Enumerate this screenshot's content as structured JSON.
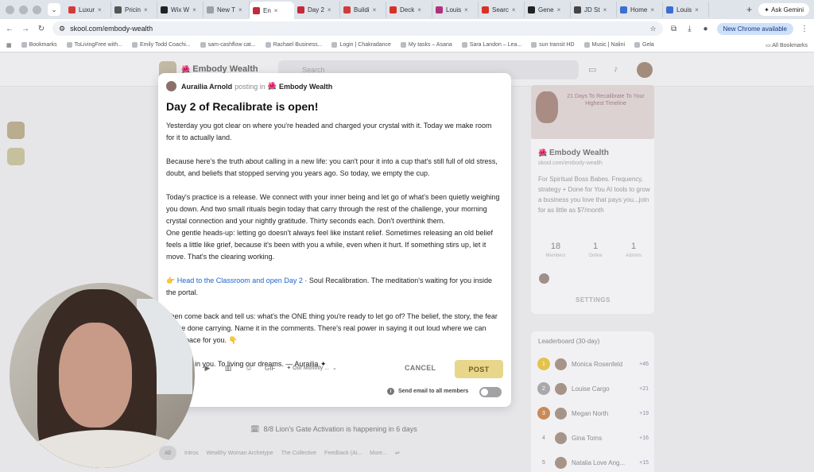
{
  "browser": {
    "tabs": [
      {
        "label": "Luxur",
        "color": "#d33a3a",
        "active": false
      },
      {
        "label": "Pricin",
        "color": "#555555",
        "active": false
      },
      {
        "label": "Wix W",
        "color": "#222222",
        "active": false
      },
      {
        "label": "New T",
        "color": "#9aa0a6",
        "active": false
      },
      {
        "label": "En",
        "color": "#c32a3b",
        "active": true
      },
      {
        "label": "Day 2",
        "color": "#c32a3b",
        "active": false
      },
      {
        "label": "Buildi",
        "color": "#d33a3a",
        "active": false
      },
      {
        "label": "Deck",
        "color": "#d93025",
        "active": false
      },
      {
        "label": "Louis",
        "color": "#b0307a",
        "active": false
      },
      {
        "label": "Searc",
        "color": "#d93025",
        "active": false
      },
      {
        "label": "Gene",
        "color": "#222222",
        "active": false
      },
      {
        "label": "JD St",
        "color": "#444444",
        "active": false
      },
      {
        "label": "Home",
        "color": "#3b6fd4",
        "active": false
      },
      {
        "label": "Louis",
        "color": "#3b6fd4",
        "active": false
      }
    ],
    "new_tab_icon": "+",
    "gemini_label": "Ask Gemini",
    "url": "skool.com/embody-wealth",
    "new_chrome_label": "New Chrome available",
    "bookmarks": [
      "Bookmarks",
      "ToLivingFree with...",
      "Emily Todd Coachi...",
      "sam-cashflow cat...",
      "Rachael Business...",
      "Login | Chakradance",
      "My tasks – Asana",
      "Sara Landon – Lea...",
      "sun transit HD",
      "Music | Nalini",
      "Gela"
    ],
    "all_bookmarks": "All Bookmarks"
  },
  "background": {
    "group_name": "Embody Wealth",
    "search_placeholder": "Search",
    "about_title": "Embody Wealth",
    "about_url": "skool.com/embody-wealth",
    "about_desc": "For Spiritual Boss Babes. Frequency, strategy + Done for You AI tools to grow a business you love that pays you...join for as little as $7/month",
    "banner_text": "21 Days To Recalibrate To Your Highest Timeline",
    "stats": [
      {
        "value": "18",
        "label": "Members"
      },
      {
        "value": "1",
        "label": "Online"
      },
      {
        "value": "1",
        "label": "Admins"
      }
    ],
    "settings_label": "SETTINGS",
    "leaderboard_title": "Leaderboard (30-day)",
    "leaderboard": [
      {
        "rank": "1",
        "name": "Monica Rosenfeld",
        "points": "+46",
        "color": "#e3c34a"
      },
      {
        "rank": "2",
        "name": "Louise Cargo",
        "points": "+21",
        "color": "#a9a9ad"
      },
      {
        "rank": "3",
        "name": "Megan North",
        "points": "+19",
        "color": "#c98a5a"
      },
      {
        "rank": "4",
        "name": "Gina Toms",
        "points": "+16",
        "color": ""
      },
      {
        "rank": "5",
        "name": "Natalia Love Ang...",
        "points": "+15",
        "color": ""
      }
    ],
    "event_prefix": "8/8 Lion's Gate Activation",
    "event_suffix": " is happening in 6 days",
    "chips": [
      "All",
      "Intros",
      "Wealthy Woman Archetype",
      "The Collective",
      "Feedback (Ai...",
      "More..."
    ]
  },
  "modal": {
    "author": "Aurailia Arnold",
    "posting_in": "posting in",
    "group": "Embody Wealth",
    "title": "Day 2 of Recalibrate is open!",
    "p1": "Yesterday you got clear on where you're headed and charged your crystal with it. Today we make room for it to actually land.",
    "p2": "Because here's the truth about calling in a new life: you can't pour it into a cup that's still full of old stress, doubt, and beliefs that stopped serving you years ago. So today, we empty the cup.",
    "p3": "Today's practice is a release. We connect with your inner being and let go of what's been quietly weighing you down. And two small rituals begin today that carry through the rest of the challenge, your morning crystal connection and your nightly gratitude. Thirty seconds each. Don't overthink them.",
    "p4": "One gentle heads-up: letting go doesn't always feel like instant relief. Sometimes releasing an old belief feels a little like grief, because it's been with you a while, even when it hurt. If something stirs up, let it move. That's the clearing working.",
    "link_emoji": "👉",
    "link_text": "Head to the Classroom and open Day 2",
    "link_rest": " · Soul Recalibration. The meditation's waiting for you inside the portal.",
    "p6": "Then come back and tell us: what's the ONE thing you're ready to let go of? The belief, the story, the fear you're done carrying. Name it in the comments. There's real power in saying it out loud where we can hold space for you. 👇",
    "p7": "I believe in you. To living our dreams. — Aurailia ✦",
    "toolbar_gif": "GIF",
    "category_label": "Our Monthly ...",
    "cancel_label": "CANCEL",
    "post_label": "POST",
    "email_label": "Send email to all members"
  }
}
